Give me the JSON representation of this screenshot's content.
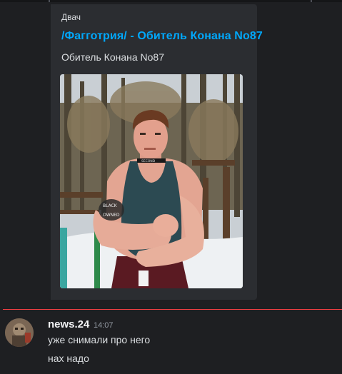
{
  "embed": {
    "provider": "Двач",
    "title": "/Фагготрия/ - Обитель Конана No87",
    "description": "Обитель Конана No87",
    "image": {
      "subject": "photo-man-tank-top-snowy-forest",
      "collar_text": "SECOND",
      "tattoo_text_1": "BLACK",
      "tattoo_text_2": "OWNED"
    }
  },
  "message": {
    "username": "news.24",
    "timestamp": "14:07",
    "lines": [
      "уже снимали про него",
      "нах надо"
    ]
  },
  "colors": {
    "background": "#1e1f22",
    "embed_background": "#2b2d31",
    "link": "#00a8fc",
    "new_messages_divider": "#f23f43",
    "text": "#dbdee1",
    "muted": "#949ba4"
  }
}
